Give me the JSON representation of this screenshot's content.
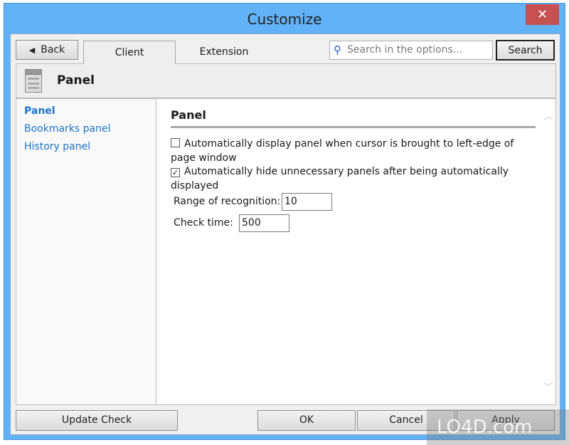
{
  "window": {
    "title": "Customize",
    "close_icon": "close-icon"
  },
  "toolbar": {
    "back_label": "Back",
    "tabs": [
      {
        "label": "Client",
        "active": true
      },
      {
        "label": "Extension",
        "active": false
      }
    ],
    "search_placeholder": "Search in the options...",
    "search_label": "Search"
  },
  "header": {
    "title": "Panel",
    "icon": "panel-icon"
  },
  "sidebar": {
    "items": [
      {
        "label": "Panel",
        "active": true
      },
      {
        "label": "Bookmarks panel"
      },
      {
        "label": "History panel"
      }
    ]
  },
  "content": {
    "section_title": "Panel",
    "options": [
      {
        "label": "Automatically display panel when cursor is brought to left-edge of page window",
        "checked": false
      },
      {
        "label": "Automatically hide unnecessary panels after being automatically displayed",
        "checked": true
      }
    ],
    "range_label": "Range of recognition:",
    "range_value": "10",
    "check_label": "Check time:",
    "check_value": "500"
  },
  "footer": {
    "update_label": "Update Check",
    "ok_label": "OK",
    "cancel_label": "Cancel",
    "apply_label": "Apply"
  },
  "watermark": "LO4D.com",
  "colors": {
    "frame": "#62b2f7",
    "close": "#c75050",
    "link": "#1c73c8"
  }
}
